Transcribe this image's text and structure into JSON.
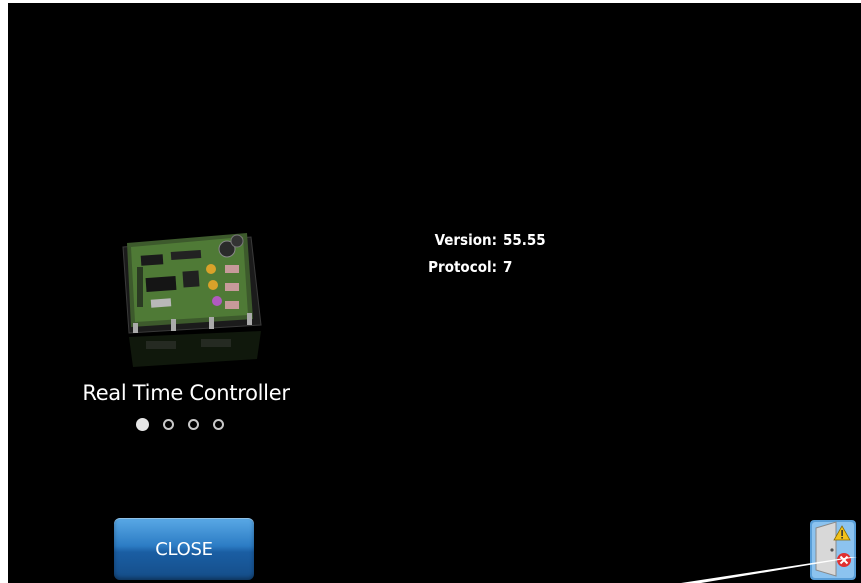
{
  "device": {
    "name": "Real Time Controller",
    "page_count": 4,
    "active_page": 1
  },
  "info": {
    "version_label": "Version:",
    "version_value": "55.55",
    "protocol_label": "Protocol:",
    "protocol_value": "7"
  },
  "close_button": {
    "label": "CLOSE"
  },
  "icons": {
    "board": "circuit-board-image",
    "exit": "exit-door-icon"
  },
  "colors": {
    "background": "#000000",
    "text": "#ffffff",
    "button": "#2c7cc4"
  }
}
